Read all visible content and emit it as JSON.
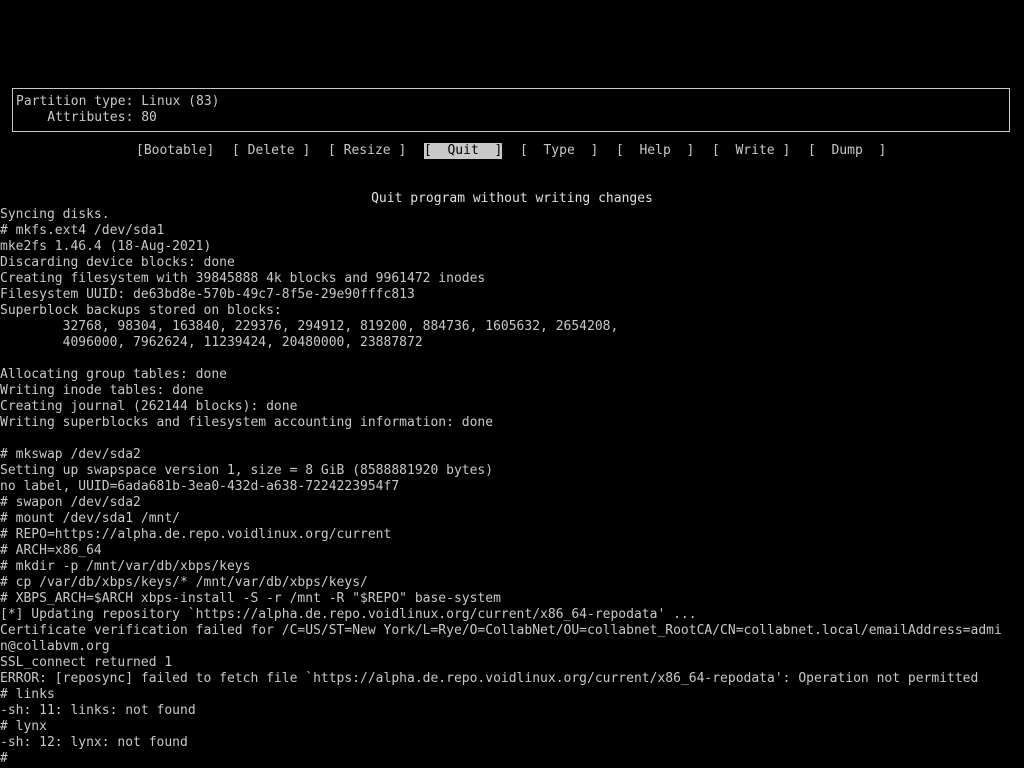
{
  "colors": {
    "background": "#000000",
    "foreground": "#c8c8c8",
    "selected_background": "#c8c8c8",
    "selected_foreground": "#000000"
  },
  "info_box": {
    "partition_type_line": "Partition type: Linux (83)",
    "attributes_line": "    Attributes: 80"
  },
  "menu": {
    "bootable": "[Bootable]",
    "delete": "[ Delete ]",
    "resize": "[ Resize ]",
    "quit": "[  Quit  ]",
    "type": "[  Type  ]",
    "help": "[  Help  ]",
    "write": "[  Write ]",
    "dump": "[  Dump  ]",
    "selected": "quit"
  },
  "hint": "Quit program without writing changes",
  "console": {
    "lines": [
      "Syncing disks.",
      "# mkfs.ext4 /dev/sda1",
      "mke2fs 1.46.4 (18-Aug-2021)",
      "Discarding device blocks: done",
      "Creating filesystem with 39845888 4k blocks and 9961472 inodes",
      "Filesystem UUID: de63bd8e-570b-49c7-8f5e-29e90fffc813",
      "Superblock backups stored on blocks:",
      "        32768, 98304, 163840, 229376, 294912, 819200, 884736, 1605632, 2654208,",
      "        4096000, 7962624, 11239424, 20480000, 23887872",
      "",
      "Allocating group tables: done",
      "Writing inode tables: done",
      "Creating journal (262144 blocks): done",
      "Writing superblocks and filesystem accounting information: done",
      "",
      "# mkswap /dev/sda2",
      "Setting up swapspace version 1, size = 8 GiB (8588881920 bytes)",
      "no label, UUID=6ada681b-3ea0-432d-a638-7224223954f7",
      "# swapon /dev/sda2",
      "# mount /dev/sda1 /mnt/",
      "# REPO=https://alpha.de.repo.voidlinux.org/current",
      "# ARCH=x86_64",
      "# mkdir -p /mnt/var/db/xbps/keys",
      "# cp /var/db/xbps/keys/* /mnt/var/db/xbps/keys/",
      "# XBPS_ARCH=$ARCH xbps-install -S -r /mnt -R \"$REPO\" base-system",
      "[*] Updating repository `https://alpha.de.repo.voidlinux.org/current/x86_64-repodata' ...",
      "Certificate verification failed for /C=US/ST=New York/L=Rye/O=CollabNet/OU=collabnet_RootCA/CN=collabnet.local/emailAddress=admi",
      "n@collabvm.org",
      "SSL_connect returned 1",
      "ERROR: [reposync] failed to fetch file `https://alpha.de.repo.voidlinux.org/current/x86_64-repodata': Operation not permitted",
      "# links",
      "-sh: 11: links: not found",
      "# lynx",
      "-sh: 12: lynx: not found"
    ],
    "prompt": "#"
  }
}
